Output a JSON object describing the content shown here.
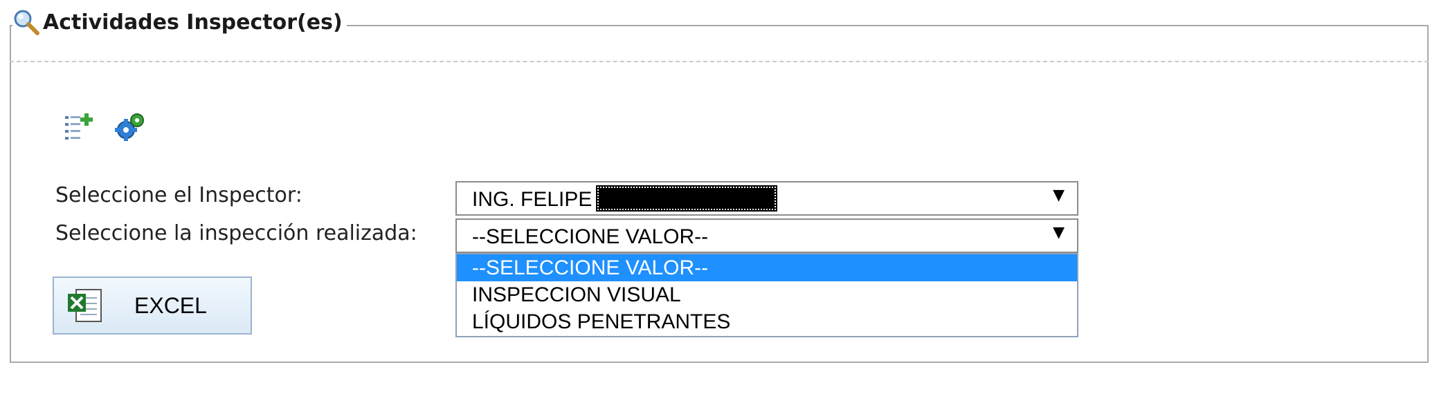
{
  "panel": {
    "title": "Actividades Inspector(es)",
    "title_icon": "magnifier-icon"
  },
  "toolbar": {
    "icons": [
      "add-list-icon",
      "settings-gears-icon"
    ]
  },
  "form": {
    "inspector_label": "Seleccione el Inspector:",
    "inspector_value": "ING. FELIPE",
    "inspection_label": "Seleccione la inspección realizada:",
    "inspection_value": "--SELECCIONE VALOR--",
    "inspection_options": [
      "--SELECCIONE VALOR--",
      "INSPECCION VISUAL",
      "LÍQUIDOS PENETRANTES"
    ],
    "selected_option_index": 0
  },
  "excel_button": {
    "label": "EXCEL",
    "icon": "excel-icon"
  },
  "colors": {
    "highlight": "#1e90ff",
    "border": "#a9a9a9",
    "button_border": "#9ab3cc"
  }
}
